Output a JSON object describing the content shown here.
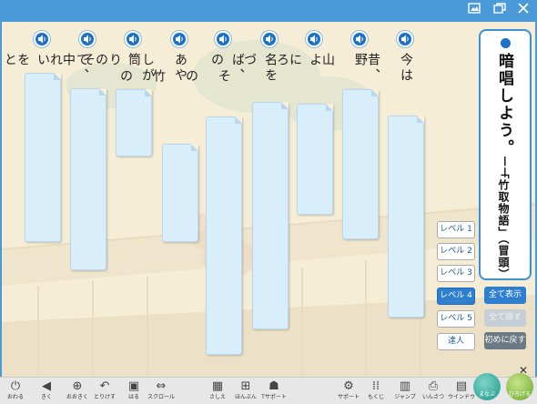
{
  "window": {
    "icons": [
      "image-icon",
      "restore-icon",
      "close-icon"
    ]
  },
  "title": {
    "main": "暗唱しよう。──",
    "sub": "「竹取物語」（冒頭）"
  },
  "columns": [
    {
      "text": "今は昔、"
    },
    {
      "text": "野山に"
    },
    {
      "text": "よろづの"
    },
    {
      "text": "名をば、"
    },
    {
      "text": "その竹の"
    },
    {
      "text": "あやしがりて、"
    },
    {
      "text": "筒の中"
    },
    {
      "text": "それを"
    },
    {
      "text": "いと"
    }
  ],
  "levels": [
    "レベル 1",
    "レベル 2",
    "レベル 3",
    "レベル 4",
    "レベル 5",
    "達人"
  ],
  "active_level": "レベル 4",
  "actions": {
    "show_all": "全て表示",
    "hide_all": "全て隠す",
    "reset": "初めに戻す"
  },
  "toolbar": [
    {
      "label": "おわる",
      "icon": "power-icon"
    },
    {
      "label": "きく",
      "icon": "speaker-icon"
    },
    {
      "label": "おおきく",
      "icon": "zoom-in-icon"
    },
    {
      "label": "とりけす",
      "icon": "undo-icon"
    },
    {
      "label": "はる",
      "icon": "paste-icon"
    },
    {
      "label": "スクロール",
      "icon": "scroll-icon"
    },
    {
      "label": "さしえ",
      "icon": "picture-icon"
    },
    {
      "label": "ほんぶん",
      "icon": "text-icon"
    },
    {
      "label": "Tサポート",
      "icon": "teacher-icon"
    },
    {
      "label": "サポート",
      "icon": "gear-icon"
    },
    {
      "label": "もくじ",
      "icon": "grid-icon"
    },
    {
      "label": "ジャンプ",
      "icon": "book-icon"
    },
    {
      "label": "いんさつ",
      "icon": "print-icon"
    },
    {
      "label": "ウインドウ",
      "icon": "window-icon"
    }
  ],
  "round_buttons": {
    "left": "まなぶ",
    "right": "ひろげる"
  },
  "colors": {
    "frame": "#4a9ad9",
    "accent": "#2f7fd0",
    "mask": "#d9eefb",
    "paper": "#f8f0dc"
  }
}
